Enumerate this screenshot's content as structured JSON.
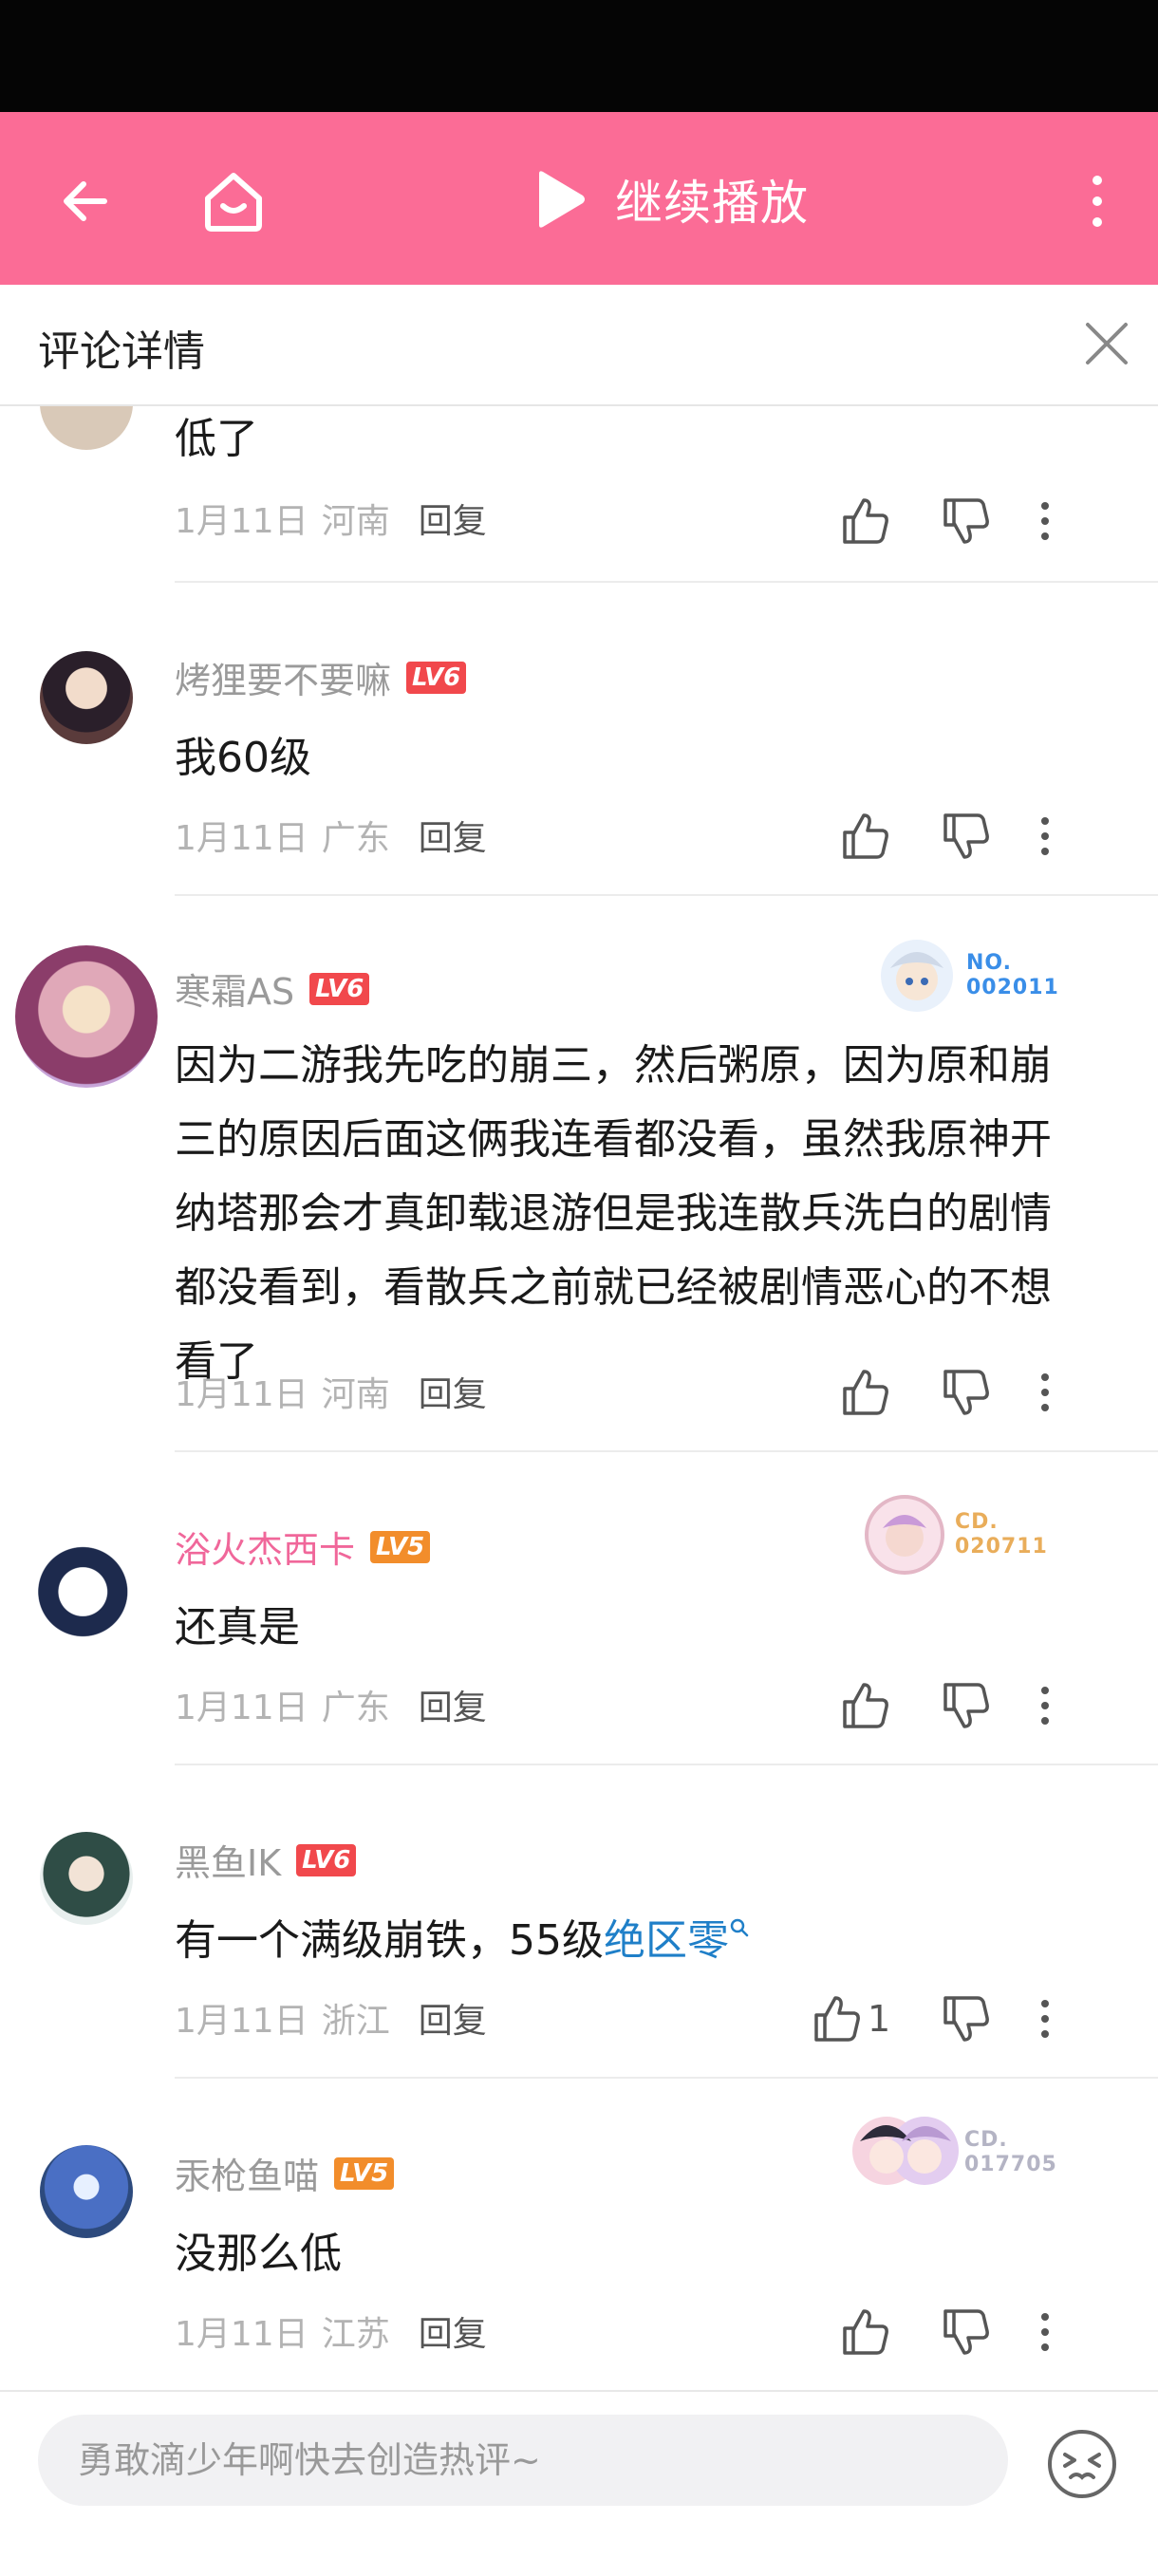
{
  "header": {
    "title": "继续播放"
  },
  "subheader": {
    "title": "评论详情"
  },
  "comments": [
    {
      "content": "低了",
      "date": "1月11日",
      "region": "河南",
      "reply": "回复"
    },
    {
      "user": "烤狸要不要嘛",
      "level": "LV6",
      "content": "我60级",
      "date": "1月11日",
      "region": "广东",
      "reply": "回复"
    },
    {
      "user": "寒霜AS",
      "level": "LV6",
      "badge": "NO.\n002011",
      "content": "因为二游我先吃的崩三，然后粥原，因为原和崩三的原因后面这俩我连看都没看，虽然我原神开纳塔那会才真卸载退游但是我连散兵洗白的剧情都没看到，看散兵之前就已经被剧情恶心的不想看了",
      "date": "1月11日",
      "region": "河南",
      "reply": "回复"
    },
    {
      "user": "浴火杰西卡",
      "level": "LV5",
      "badge": "CD.\n020711",
      "content": "还真是",
      "date": "1月11日",
      "region": "广东",
      "reply": "回复"
    },
    {
      "user": "黑鱼IK",
      "level": "LV6",
      "content": "有一个满级崩铁，55级",
      "link": "绝区零",
      "date": "1月11日",
      "region": "浙江",
      "reply": "回复",
      "likes": "1"
    },
    {
      "user": "汞枪鱼喵",
      "level": "LV5",
      "badge": "CD.\n017705",
      "content": "没那么低",
      "date": "1月11日",
      "region": "江苏",
      "reply": "回复"
    }
  ],
  "input": {
    "placeholder": "勇敢滴少年啊快去创造热评~"
  },
  "colors": {
    "accent": "#fb6c96",
    "link": "#1f7fc8",
    "lv6": "#f1484c",
    "lv5": "#f28d2b"
  }
}
